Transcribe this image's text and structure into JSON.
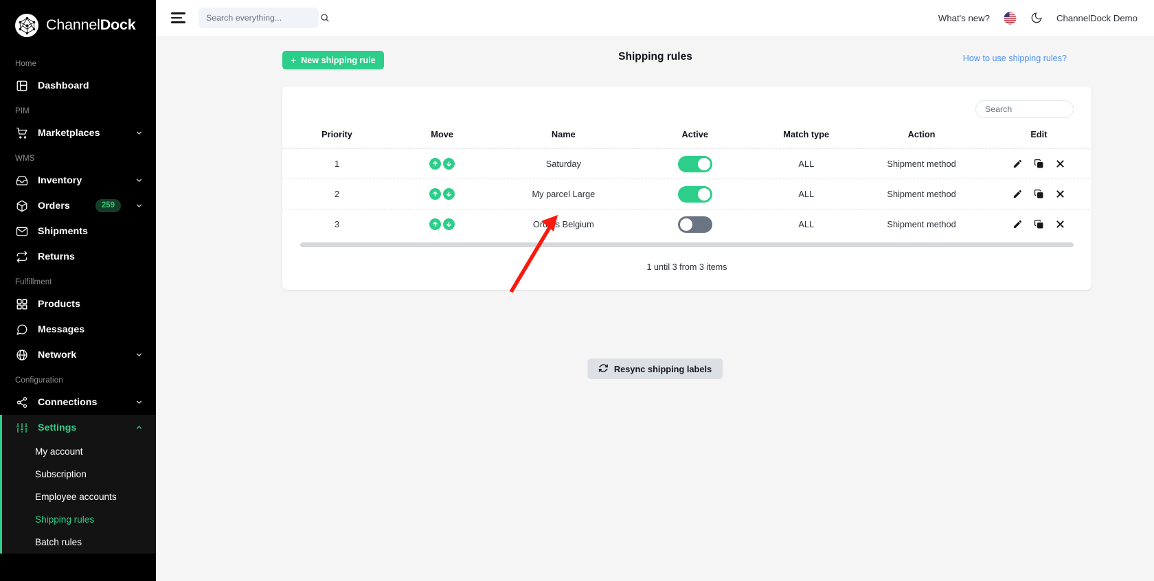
{
  "brand": {
    "name_light": "Channel",
    "name_bold": "Dock",
    "logo_icon": "channeldock-polyhedron-logo"
  },
  "sidebar": {
    "sections": [
      {
        "label": "Home",
        "items": [
          {
            "label": "Dashboard",
            "icon": "layout-dashboard-icon",
            "expandable": false
          }
        ]
      },
      {
        "label": "PIM",
        "items": [
          {
            "label": "Marketplaces",
            "icon": "shopping-cart-icon",
            "expandable": true
          }
        ]
      },
      {
        "label": "WMS",
        "items": [
          {
            "label": "Inventory",
            "icon": "inbox-icon",
            "expandable": true
          },
          {
            "label": "Orders",
            "icon": "box-icon",
            "expandable": true,
            "badge": "259"
          },
          {
            "label": "Shipments",
            "icon": "envelope-icon",
            "expandable": false
          },
          {
            "label": "Returns",
            "icon": "return-arrows-icon",
            "expandable": false
          }
        ]
      },
      {
        "label": "Fulfillment",
        "items": [
          {
            "label": "Products",
            "icon": "grid-squares-icon",
            "expandable": false
          },
          {
            "label": "Messages",
            "icon": "chat-bubble-icon",
            "expandable": false
          },
          {
            "label": "Network",
            "icon": "globe-icon",
            "expandable": true
          }
        ]
      },
      {
        "label": "Configuration",
        "items": [
          {
            "label": "Connections",
            "icon": "share-nodes-icon",
            "expandable": true
          },
          {
            "label": "Settings",
            "icon": "sliders-icon",
            "expandable": true,
            "expanded": true,
            "active": true,
            "children": [
              {
                "label": "My account",
                "active": false
              },
              {
                "label": "Subscription",
                "active": false
              },
              {
                "label": "Employee accounts",
                "active": false
              },
              {
                "label": "Shipping rules",
                "active": true
              },
              {
                "label": "Batch rules",
                "active": false
              }
            ]
          }
        ]
      }
    ]
  },
  "topbar": {
    "menu_icon": "hamburger-menu-icon",
    "search_placeholder": "Search everything...",
    "search_value": "",
    "search_icon": "magnifier-icon",
    "whats_new": "What's new?",
    "flag_icon": "us-flag-icon",
    "theme_icon": "moon-dark-mode-icon",
    "account_name": "ChannelDock Demo"
  },
  "page": {
    "title": "Shipping rules",
    "new_rule_button": "New shipping rule",
    "new_rule_plus": "+",
    "how_to_link": "How to use shipping rules?",
    "resync_button": "Resync shipping labels",
    "resync_icon": "refresh-sync-icon",
    "pagination_text": "1 until 3 from 3 items"
  },
  "table": {
    "search_placeholder": "Search",
    "search_value": "",
    "columns": [
      "Priority",
      "Move",
      "Name",
      "Active",
      "Match type",
      "Action",
      "Edit"
    ],
    "rows": [
      {
        "priority": "1",
        "name": "Saturday",
        "active": true,
        "match_type": "ALL",
        "action": "Shipment method"
      },
      {
        "priority": "2",
        "name": "My parcel Large",
        "active": true,
        "match_type": "ALL",
        "action": "Shipment method"
      },
      {
        "priority": "3",
        "name": "Orders Belgium",
        "active": false,
        "match_type": "ALL",
        "action": "Shipment method"
      }
    ],
    "row_icons": {
      "move_up": "arrow-up-circle-icon",
      "move_down": "arrow-down-circle-icon",
      "edit": "pencil-edit-icon",
      "duplicate": "copy-duplicate-icon",
      "delete": "close-x-icon"
    }
  },
  "colors": {
    "brand_green": "#2dce89",
    "sidebar_bg": "#000000",
    "toggle_off": "#6b7482",
    "link_blue": "#4a8ef0",
    "annotation_red": "#f91a0d"
  }
}
